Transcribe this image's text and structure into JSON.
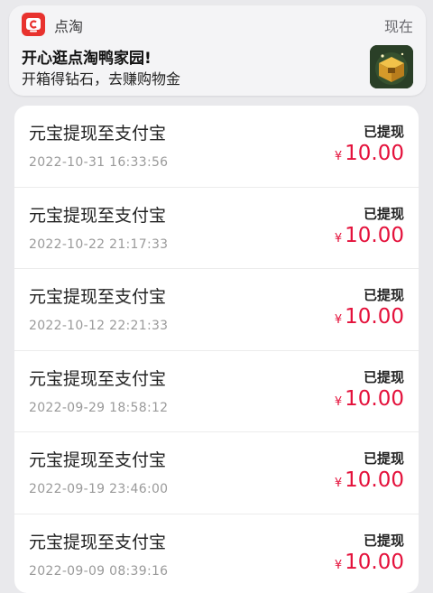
{
  "notification": {
    "app_name": "点淘",
    "time": "现在",
    "title": "开心逛点淘鸭家园!",
    "body": "开箱得钻石，去赚购物金",
    "icon": "dian-tao-app-icon",
    "thumbnail": "treasure-box-image"
  },
  "records": [
    {
      "title": "元宝提现至支付宝",
      "date": "2022-10-31 16:33:56",
      "status": "已提现",
      "currency": "¥",
      "amount": "10.00"
    },
    {
      "title": "元宝提现至支付宝",
      "date": "2022-10-22 21:17:33",
      "status": "已提现",
      "currency": "¥",
      "amount": "10.00"
    },
    {
      "title": "元宝提现至支付宝",
      "date": "2022-10-12 22:21:33",
      "status": "已提现",
      "currency": "¥",
      "amount": "10.00"
    },
    {
      "title": "元宝提现至支付宝",
      "date": "2022-09-29 18:58:12",
      "status": "已提现",
      "currency": "¥",
      "amount": "10.00"
    },
    {
      "title": "元宝提现至支付宝",
      "date": "2022-09-19 23:46:00",
      "status": "已提现",
      "currency": "¥",
      "amount": "10.00"
    },
    {
      "title": "元宝提现至支付宝",
      "date": "2022-09-09 08:39:16",
      "status": "已提现",
      "currency": "¥",
      "amount": "10.00"
    }
  ],
  "colors": {
    "accent": "#e4113b",
    "app_icon": "#e8322e"
  }
}
